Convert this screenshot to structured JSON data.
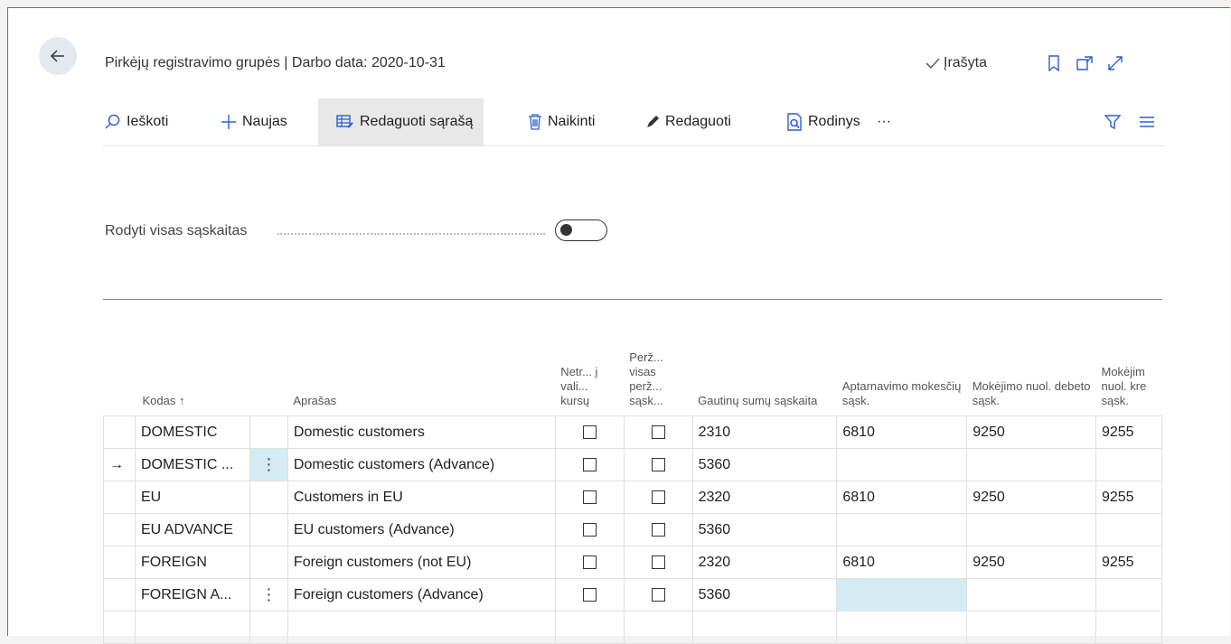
{
  "header": {
    "title": "Pirkėjų registravimo grupės | Darbo data: 2020-10-31",
    "saved_label": "Įrašyta"
  },
  "toolbar": {
    "search": "Ieškoti",
    "new": "Naujas",
    "edit_list": "Redaguoti sąrašą",
    "delete": "Naikinti",
    "edit": "Redaguoti",
    "view": "Rodinys",
    "more": "···"
  },
  "toggle": {
    "label": "Rodyti visas sąskaitas",
    "on": false
  },
  "table": {
    "columns": [
      "",
      "Kodas",
      "",
      "Aprašas",
      "Netr... į vali... kursų",
      "Perž... visas perž... sąsk...",
      "Gautinų sumų sąskaita",
      "Aptarnavimo mokesčių sąsk.",
      "Mokėjimo nuol. debeto sąsk.",
      "Mokėjim nuol. kre sąsk."
    ],
    "sort_indicator": "↑",
    "rows": [
      {
        "marker": "",
        "code": "DOMESTIC",
        "desc": "Domestic customers",
        "recv": "2310",
        "service": "6810",
        "disc_debit": "9250",
        "disc_credit": "9255"
      },
      {
        "marker": "→",
        "code": "DOMESTIC ...",
        "desc": "Domestic customers (Advance)",
        "recv": "5360",
        "service": "",
        "disc_debit": "",
        "disc_credit": ""
      },
      {
        "marker": "",
        "code": "EU",
        "desc": "Customers in EU",
        "recv": "2320",
        "service": "6810",
        "disc_debit": "9250",
        "disc_credit": "9255"
      },
      {
        "marker": "",
        "code": "EU ADVANCE",
        "desc": "EU customers (Advance)",
        "recv": "5360",
        "service": "",
        "disc_debit": "",
        "disc_credit": ""
      },
      {
        "marker": "",
        "code": "FOREIGN",
        "desc": "Foreign customers (not EU)",
        "recv": "2320",
        "service": "6810",
        "disc_debit": "9250",
        "disc_credit": "9255"
      },
      {
        "marker": "",
        "code": "FOREIGN A...",
        "desc": "Foreign customers (Advance)",
        "recv": "5360",
        "service": "",
        "disc_debit": "",
        "disc_credit": ""
      }
    ]
  },
  "colors": {
    "accent": "#2c5fd3",
    "selection": "#d4ecf1"
  }
}
